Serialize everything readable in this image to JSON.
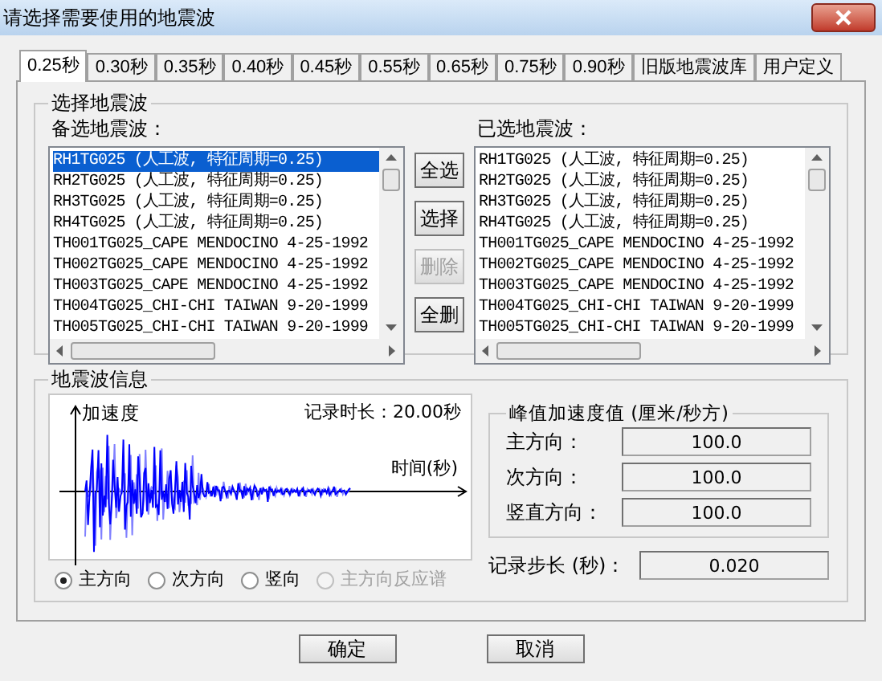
{
  "window": {
    "title": "请选择需要使用的地震波"
  },
  "tabs": [
    {
      "label": "0.25秒",
      "selected": true
    },
    {
      "label": "0.30秒",
      "selected": false
    },
    {
      "label": "0.35秒",
      "selected": false
    },
    {
      "label": "0.40秒",
      "selected": false
    },
    {
      "label": "0.45秒",
      "selected": false
    },
    {
      "label": "0.55秒",
      "selected": false
    },
    {
      "label": "0.65秒",
      "selected": false
    },
    {
      "label": "0.75秒",
      "selected": false
    },
    {
      "label": "0.90秒",
      "selected": false
    },
    {
      "label": "旧版地震波库",
      "selected": false
    },
    {
      "label": "用户定义",
      "selected": false
    }
  ],
  "wave_selection": {
    "title": "选择地震波",
    "available": {
      "label": "备选地震波：",
      "items": [
        {
          "text": "RH1TG025 (人工波, 特征周期=0.25)",
          "selected": true
        },
        {
          "text": "RH2TG025 (人工波, 特征周期=0.25)",
          "selected": false
        },
        {
          "text": "RH3TG025 (人工波, 特征周期=0.25)",
          "selected": false
        },
        {
          "text": "RH4TG025 (人工波, 特征周期=0.25)",
          "selected": false
        },
        {
          "text": "TH001TG025_CAPE MENDOCINO 4-25-1992",
          "selected": false
        },
        {
          "text": "TH002TG025_CAPE MENDOCINO 4-25-1992",
          "selected": false
        },
        {
          "text": "TH003TG025_CAPE MENDOCINO 4-25-1992",
          "selected": false
        },
        {
          "text": "TH004TG025_CHI-CHI TAIWAN 9-20-1999",
          "selected": false
        },
        {
          "text": "TH005TG025_CHI-CHI TAIWAN 9-20-1999",
          "selected": false
        }
      ]
    },
    "buttons": [
      {
        "label": "全选",
        "disabled": false
      },
      {
        "label": "选择",
        "disabled": false
      },
      {
        "label": "删除",
        "disabled": true
      },
      {
        "label": "全删",
        "disabled": false
      }
    ],
    "chosen": {
      "label": "已选地震波：",
      "items": [
        {
          "text": "RH1TG025 (人工波, 特征周期=0.25)",
          "selected": false
        },
        {
          "text": "RH2TG025 (人工波, 特征周期=0.25)",
          "selected": false
        },
        {
          "text": "RH3TG025 (人工波, 特征周期=0.25)",
          "selected": false
        },
        {
          "text": "RH4TG025 (人工波, 特征周期=0.25)",
          "selected": false
        },
        {
          "text": "TH001TG025_CAPE MENDOCINO 4-25-1992",
          "selected": false
        },
        {
          "text": "TH002TG025_CAPE MENDOCINO 4-25-1992",
          "selected": false
        },
        {
          "text": "TH003TG025_CAPE MENDOCINO 4-25-1992",
          "selected": false
        },
        {
          "text": "TH004TG025_CHI-CHI TAIWAN 9-20-1999",
          "selected": false
        },
        {
          "text": "TH005TG025_CHI-CHI TAIWAN 9-20-1999",
          "selected": false
        }
      ]
    }
  },
  "wave_info": {
    "title": "地震波信息",
    "chart": {
      "y_axis_label": "加速度",
      "duration": "记录时长：20.00秒",
      "x_axis_label": "时间(秒)"
    },
    "radios": [
      {
        "label": "主方向",
        "selected": true,
        "disabled": false
      },
      {
        "label": "次方向",
        "selected": false,
        "disabled": false
      },
      {
        "label": "竖向",
        "selected": false,
        "disabled": false
      },
      {
        "label": "主方向反应谱",
        "selected": false,
        "disabled": true
      }
    ],
    "peak": {
      "title": "峰值加速度值 (厘米/秒方)",
      "fields": [
        {
          "label": "主方向：",
          "value": "100.0"
        },
        {
          "label": "次方向：",
          "value": "100.0"
        },
        {
          "label": "竖直方向：",
          "value": "100.0"
        }
      ]
    },
    "step": {
      "label": "记录步长 (秒)：",
      "value": "0.020"
    }
  },
  "buttons": [
    {
      "label": "确定"
    },
    {
      "label": "取消"
    }
  ]
}
